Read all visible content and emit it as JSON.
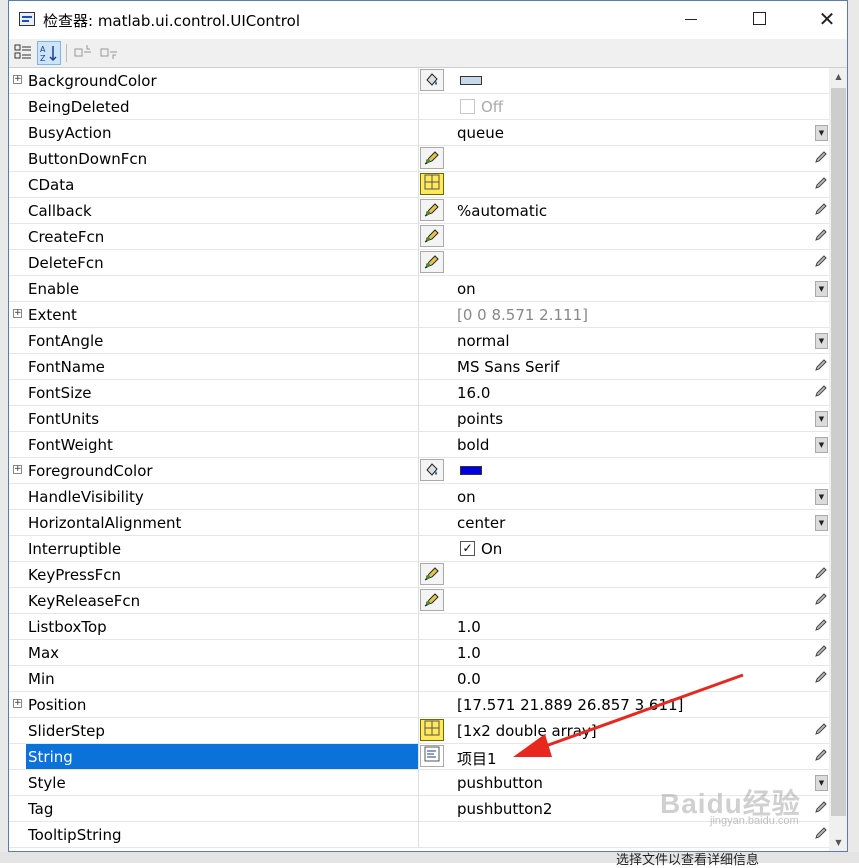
{
  "window": {
    "title": "检查器: matlab.ui.control.UIControl",
    "minimize_icon": "minimize-icon",
    "maximize_icon": "maximize-icon",
    "close_icon": "close-icon"
  },
  "toolbar": {
    "categorized_icon": "categorized-view-icon",
    "sort_icon": "alphabetical-sort-icon",
    "expand_icon": "expand-all-icon",
    "collapse_icon": "collapse-all-icon"
  },
  "colors": {
    "selection": "#0a72d8",
    "background_color_swatch": "#c8d8ec",
    "foreground_color_swatch": "#0000e6",
    "annotation_arrow": "#e8281e"
  },
  "properties": [
    {
      "name": "BackgroundColor",
      "expandable": true,
      "editor": "color",
      "value": "",
      "swatch": "#c8d8ec",
      "control": "none"
    },
    {
      "name": "BeingDeleted",
      "expandable": false,
      "editor": "none",
      "value": "",
      "checkbox": {
        "checked": false,
        "label": "Off",
        "disabled": true
      },
      "control": "none"
    },
    {
      "name": "BusyAction",
      "expandable": false,
      "editor": "none",
      "value": "queue",
      "control": "dropdown"
    },
    {
      "name": "ButtonDownFcn",
      "expandable": false,
      "editor": "callback",
      "value": "",
      "control": "pencil"
    },
    {
      "name": "CData",
      "expandable": false,
      "editor": "array",
      "value": "",
      "control": "pencil"
    },
    {
      "name": "Callback",
      "expandable": false,
      "editor": "callback",
      "value": "%automatic",
      "control": "pencil"
    },
    {
      "name": "CreateFcn",
      "expandable": false,
      "editor": "callback",
      "value": "",
      "control": "pencil"
    },
    {
      "name": "DeleteFcn",
      "expandable": false,
      "editor": "callback",
      "value": "",
      "control": "pencil"
    },
    {
      "name": "Enable",
      "expandable": false,
      "editor": "none",
      "value": "on",
      "control": "dropdown"
    },
    {
      "name": "Extent",
      "expandable": true,
      "editor": "none",
      "value": "[0 0 8.571 2.111]",
      "gray": true,
      "control": "none"
    },
    {
      "name": "FontAngle",
      "expandable": false,
      "editor": "none",
      "value": "normal",
      "control": "dropdown"
    },
    {
      "name": "FontName",
      "expandable": false,
      "editor": "none",
      "value": "MS Sans Serif",
      "control": "pencil"
    },
    {
      "name": "FontSize",
      "expandable": false,
      "editor": "none",
      "value": "16.0",
      "control": "pencil"
    },
    {
      "name": "FontUnits",
      "expandable": false,
      "editor": "none",
      "value": "points",
      "control": "dropdown"
    },
    {
      "name": "FontWeight",
      "expandable": false,
      "editor": "none",
      "value": "bold",
      "control": "dropdown"
    },
    {
      "name": "ForegroundColor",
      "expandable": true,
      "editor": "color",
      "value": "",
      "swatch": "#0000e6",
      "control": "none"
    },
    {
      "name": "HandleVisibility",
      "expandable": false,
      "editor": "none",
      "value": "on",
      "control": "dropdown"
    },
    {
      "name": "HorizontalAlignment",
      "expandable": false,
      "editor": "none",
      "value": "center",
      "control": "dropdown"
    },
    {
      "name": "Interruptible",
      "expandable": false,
      "editor": "none",
      "value": "",
      "checkbox": {
        "checked": true,
        "label": "On",
        "disabled": false
      },
      "control": "none"
    },
    {
      "name": "KeyPressFcn",
      "expandable": false,
      "editor": "callback",
      "value": "",
      "control": "pencil"
    },
    {
      "name": "KeyReleaseFcn",
      "expandable": false,
      "editor": "callback",
      "value": "",
      "control": "pencil"
    },
    {
      "name": "ListboxTop",
      "expandable": false,
      "editor": "none",
      "value": "1.0",
      "control": "pencil"
    },
    {
      "name": "Max",
      "expandable": false,
      "editor": "none",
      "value": "1.0",
      "control": "pencil"
    },
    {
      "name": "Min",
      "expandable": false,
      "editor": "none",
      "value": "0.0",
      "control": "pencil"
    },
    {
      "name": "Position",
      "expandable": true,
      "editor": "none",
      "value": "[17.571 21.889 26.857 3.611]",
      "control": "none"
    },
    {
      "name": "SliderStep",
      "expandable": false,
      "editor": "array",
      "value": "[1x2  double array]",
      "control": "pencil"
    },
    {
      "name": "String",
      "expandable": false,
      "editor": "text",
      "value": "项目1",
      "selected": true,
      "control": "pencil"
    },
    {
      "name": "Style",
      "expandable": false,
      "editor": "none",
      "value": "pushbutton",
      "control": "dropdown"
    },
    {
      "name": "Tag",
      "expandable": false,
      "editor": "none",
      "value": "pushbutton2",
      "control": "pencil"
    },
    {
      "name": "TooltipString",
      "expandable": false,
      "editor": "none",
      "value": "",
      "control": "pencil"
    }
  ],
  "background": {
    "bottom_text": "选择文件以查看详细信息",
    "watermark": "Baidu经验",
    "watermark_url": "jingyan.baidu.com"
  }
}
